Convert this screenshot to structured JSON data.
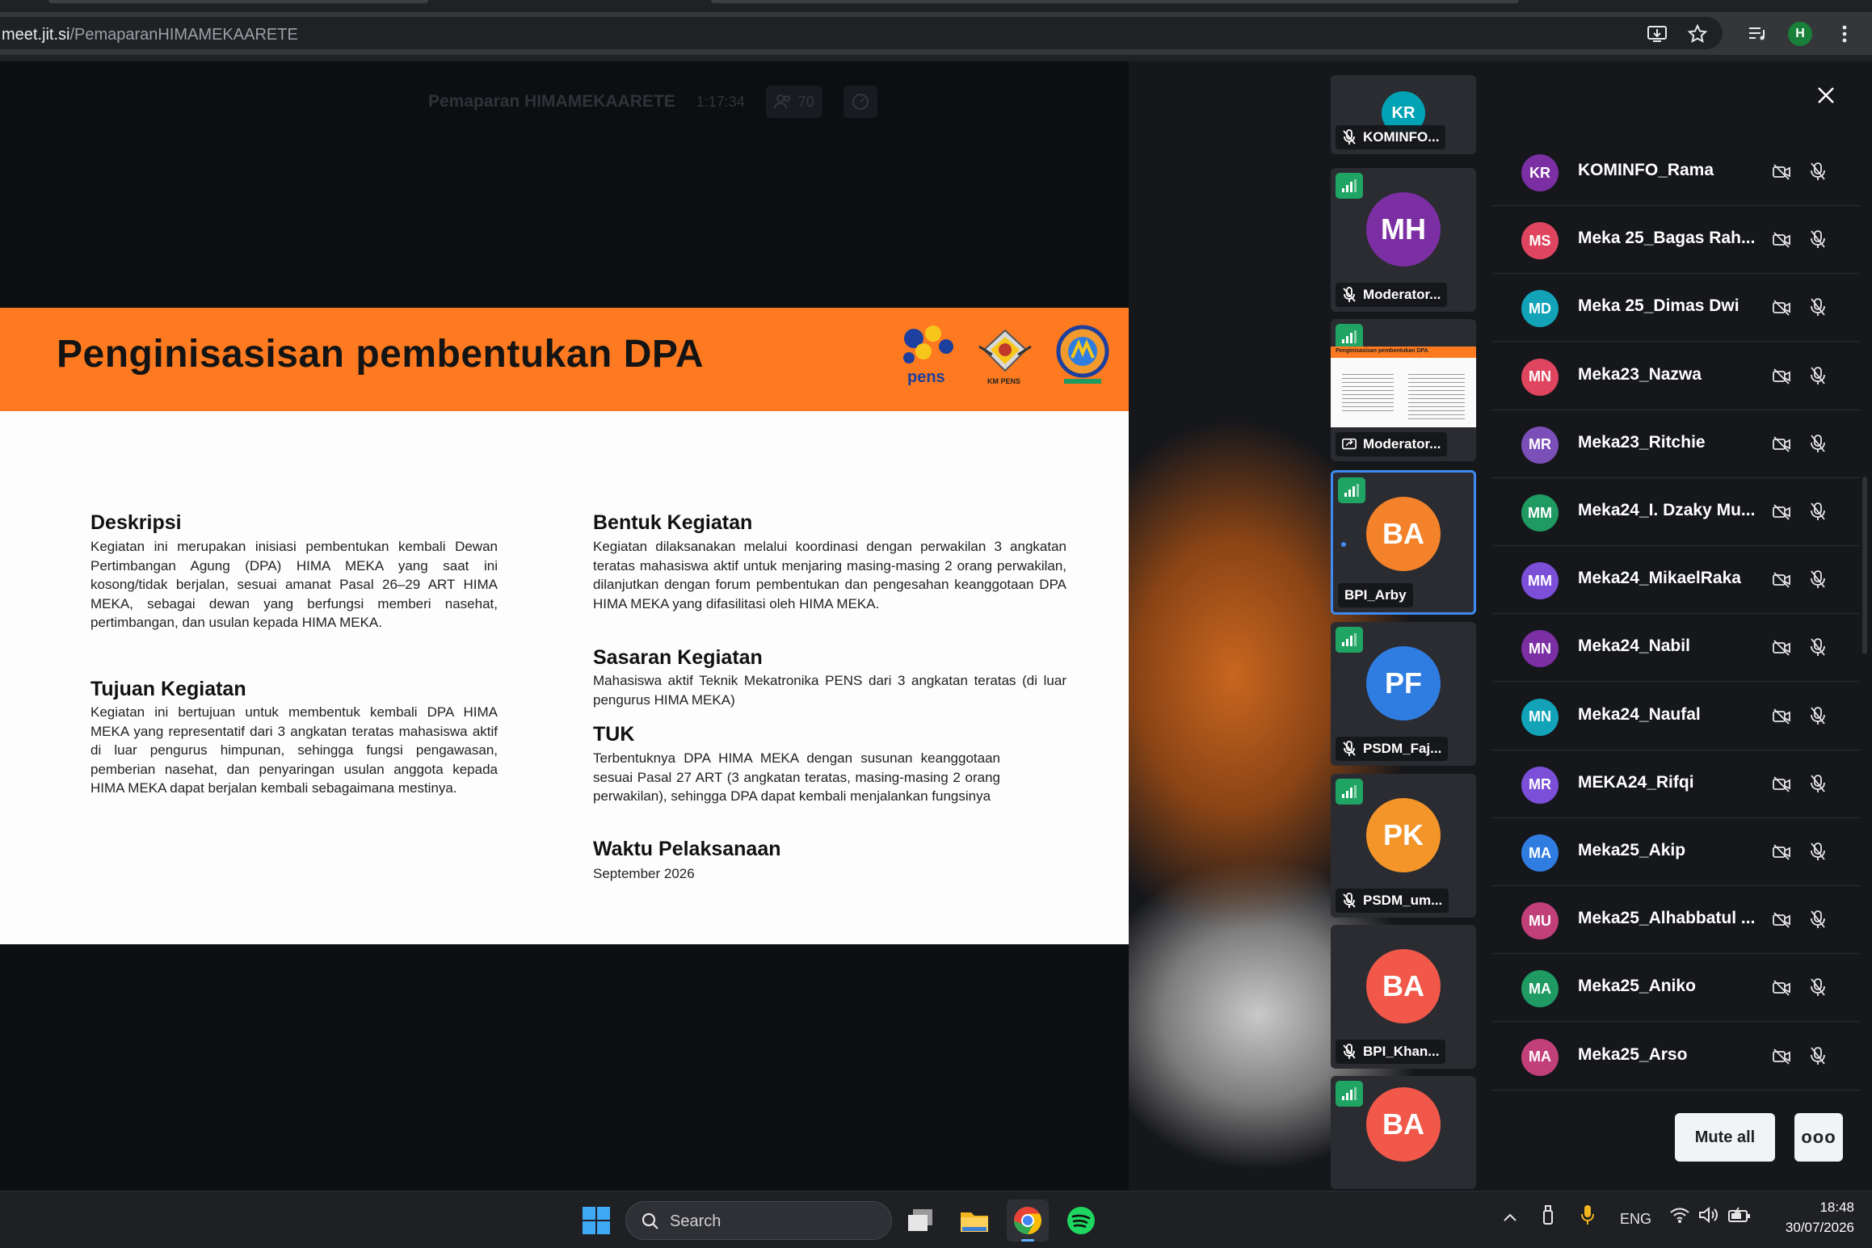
{
  "browser": {
    "url_host": "meet.jit.si",
    "url_path": "/PemaparanHIMAMEKAARETE",
    "profile_initial": "H"
  },
  "meeting": {
    "title": "Pemaparan HIMAMEKAARETE",
    "elapsed": "1:17:34",
    "participant_count": "70"
  },
  "slide": {
    "title": "Penginisasisan pembentukan DPA",
    "logo_caption_1": "pens",
    "logo_caption_2": "KM PENS",
    "sections": {
      "deskripsi_h": "Deskripsi",
      "deskripsi_p": "Kegiatan ini merupakan inisiasi pembentukan kembali Dewan Pertimbangan Agung (DPA) HIMA MEKA yang saat ini kosong/tidak berjalan, sesuai amanat Pasal 26–29 ART HIMA MEKA, sebagai dewan yang berfungsi memberi nasehat, pertimbangan, dan usulan kepada HIMA MEKA.",
      "tujuan_h": "Tujuan Kegiatan",
      "tujuan_p": "Kegiatan ini bertujuan untuk membentuk kembali DPA HIMA MEKA yang representatif dari 3 angkatan teratas mahasiswa aktif di luar pengurus himpunan, sehingga fungsi pengawasan, pemberian nasehat, dan penyaringan usulan anggota kepada HIMA MEKA dapat berjalan kembali sebagaimana mestinya.",
      "bentuk_h": "Bentuk Kegiatan",
      "bentuk_p": "Kegiatan dilaksanakan melalui koordinasi dengan perwakilan 3 angkatan teratas mahasiswa aktif untuk menjaring masing-masing 2 orang perwakilan, dilanjutkan dengan forum pembentukan dan pengesahan keanggotaan DPA HIMA MEKA yang difasilitasi oleh HIMA MEKA.",
      "sasaran_h": "Sasaran Kegiatan",
      "sasaran_p": "Mahasiswa aktif Teknik Mekatronika PENS dari 3 angkatan teratas (di luar pengurus HIMA MEKA)",
      "tuk_h": "TUK",
      "tuk_p": "Terbentuknya DPA HIMA MEKA dengan susunan keanggotaan sesuai Pasal 27 ART (3 angkatan teratas, masing-masing 2 orang perwakilan), sehingga DPA dapat kembali menjalankan fungsinya",
      "waktu_h": "Waktu Pelaksanaan",
      "waktu_p": "September 2026"
    }
  },
  "filmstrip": [
    {
      "initials": "KR",
      "label": "KOMINFO...",
      "color": "#00a3b4",
      "muted": true,
      "signal": false
    },
    {
      "initials": "MH",
      "label": "Moderator...",
      "color": "#7b2fa3",
      "muted": true,
      "signal": true
    },
    {
      "initials": "",
      "label": "Moderator...",
      "color": "",
      "muted": false,
      "signal": true,
      "screenshare": true,
      "thumb_title": "Penginisasisan pembentukan DPA"
    },
    {
      "initials": "BA",
      "label": "BPI_Arby",
      "color": "#f4822a",
      "muted": false,
      "signal": true,
      "active": true
    },
    {
      "initials": "PF",
      "label": "PSDM_Faj...",
      "color": "#2f7de1",
      "muted": true,
      "signal": true
    },
    {
      "initials": "PK",
      "label": "PSDM_um...",
      "color": "#f4952a",
      "muted": true,
      "signal": true
    },
    {
      "initials": "BA",
      "label": "BPI_Khan...",
      "color": "#f1584a",
      "muted": true,
      "signal": false
    },
    {
      "initials": "BA",
      "label": "",
      "color": "#f1584a",
      "muted": false,
      "signal": true
    }
  ],
  "participants": [
    {
      "initials": "KR",
      "name": "KOMINFO_Rama",
      "color": "#7b2fa3"
    },
    {
      "initials": "MS",
      "name": "Meka 25_Bagas Rah...",
      "color": "#e0455f"
    },
    {
      "initials": "MD",
      "name": "Meka 25_Dimas Dwi",
      "color": "#12a3b8"
    },
    {
      "initials": "MN",
      "name": "Meka23_Nazwa",
      "color": "#e0455f"
    },
    {
      "initials": "MR",
      "name": "Meka23_Ritchie",
      "color": "#7b4fb8"
    },
    {
      "initials": "MM",
      "name": "Meka24_I. Dzaky Mu...",
      "color": "#1e9a62"
    },
    {
      "initials": "MM",
      "name": "Meka24_MikaelRaka",
      "color": "#7b4fd8"
    },
    {
      "initials": "MN",
      "name": "Meka24_Nabil",
      "color": "#7b2fa3"
    },
    {
      "initials": "MN",
      "name": "Meka24_Naufal",
      "color": "#12a3b8"
    },
    {
      "initials": "MR",
      "name": "MEKA24_Rifqi",
      "color": "#7b4fd8"
    },
    {
      "initials": "MA",
      "name": "Meka25_Akip",
      "color": "#2f7de1"
    },
    {
      "initials": "MU",
      "name": "Meka25_Alhabbatul ...",
      "color": "#c2407a"
    },
    {
      "initials": "MA",
      "name": "Meka25_Aniko",
      "color": "#1e9a62"
    },
    {
      "initials": "MA",
      "name": "Meka25_Arso",
      "color": "#c2407a"
    }
  ],
  "panel": {
    "mute_all_label": "Mute all",
    "more_label": "ooo"
  },
  "taskbar": {
    "search_placeholder": "Search",
    "language": "ENG",
    "time": "18:48",
    "date": "30/07/2026"
  }
}
